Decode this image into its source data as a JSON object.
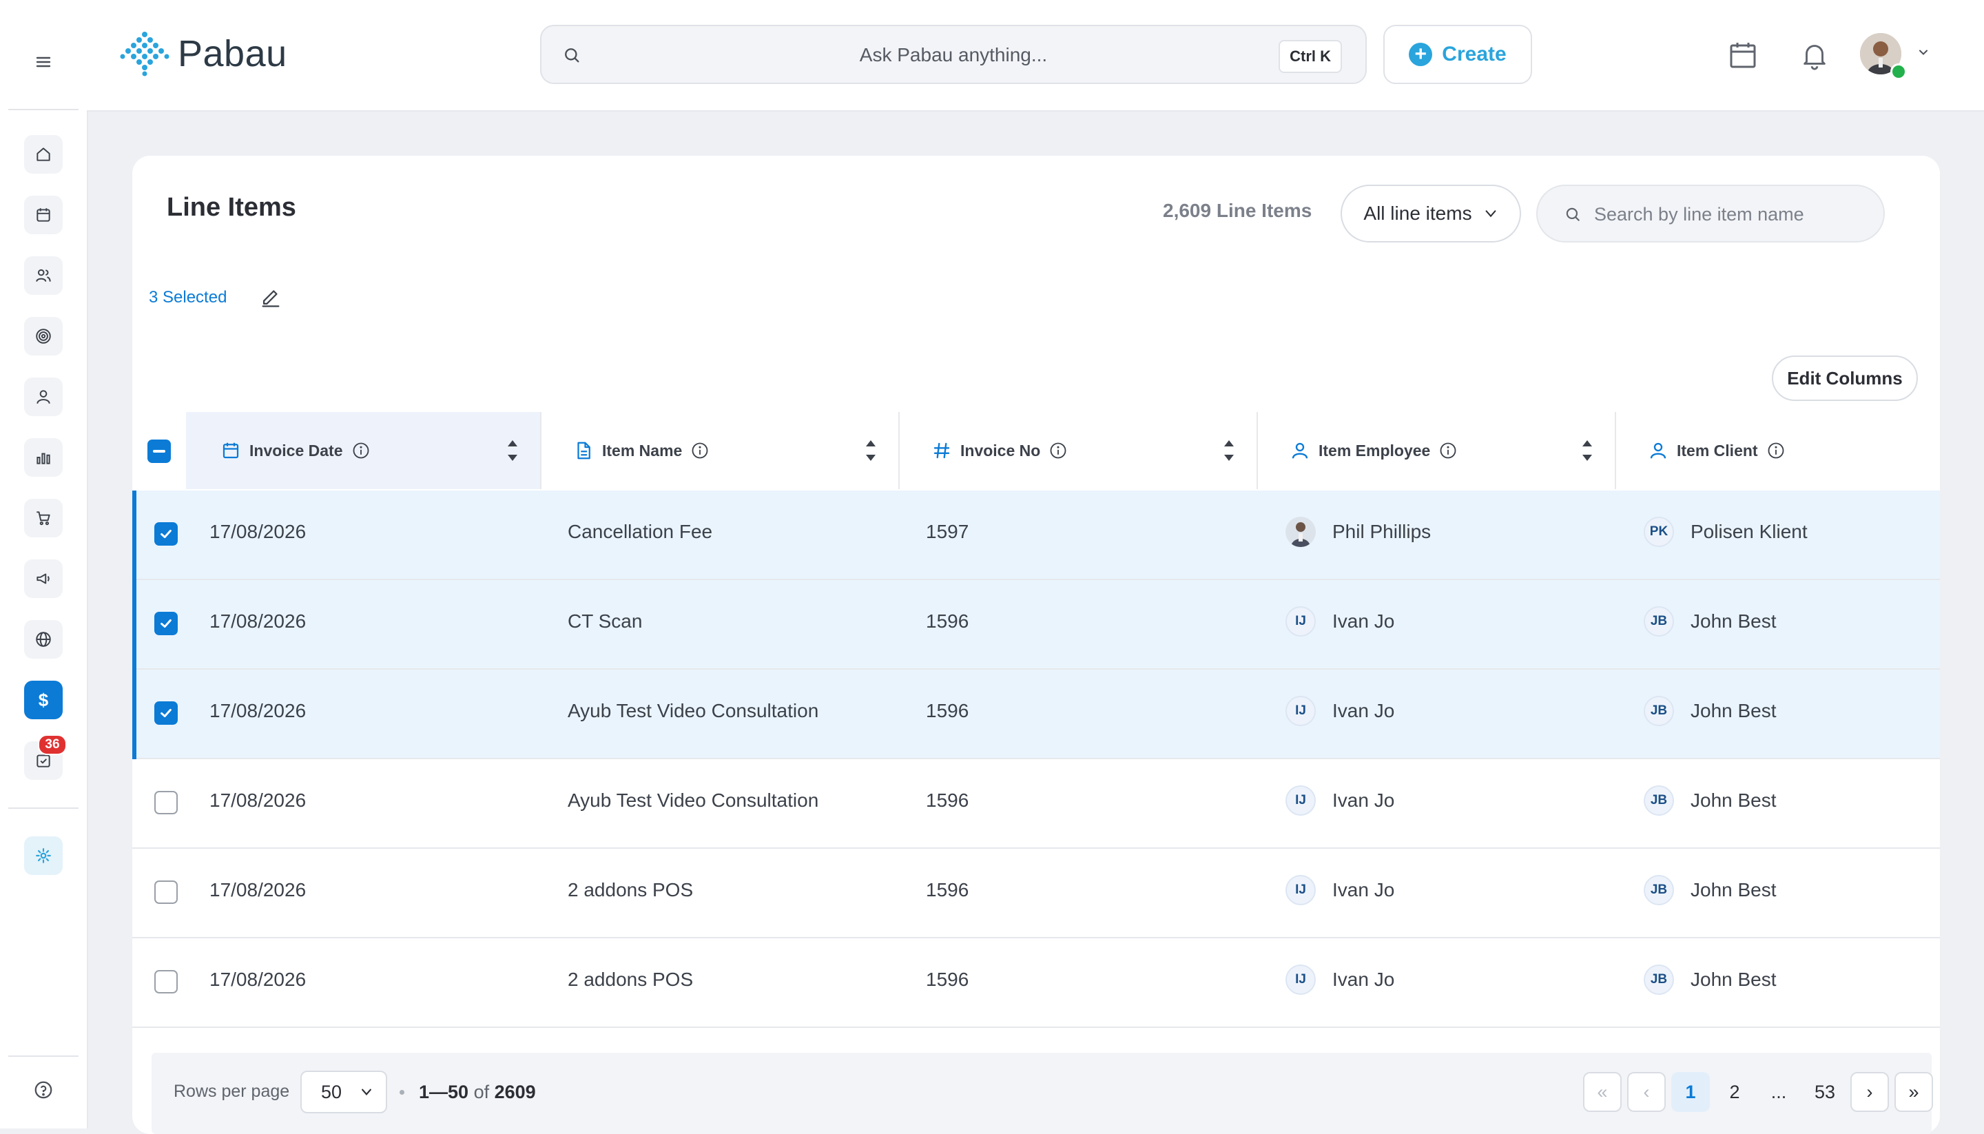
{
  "app": {
    "name": "Pabau"
  },
  "topbar": {
    "ai_search_placeholder": "Ask Pabau anything...",
    "shortcut": "Ctrl K",
    "create_label": "Create"
  },
  "sidebar": {
    "tasks_badge": "36"
  },
  "page": {
    "title": "Line Items",
    "count_label": "2,609 Line Items",
    "filter_label": "All line items",
    "search_placeholder": "Search by line item name",
    "selected_label": "3 Selected",
    "edit_columns_label": "Edit Columns"
  },
  "table": {
    "columns": [
      "Invoice Date",
      "Item Name",
      "Invoice No",
      "Item Employee",
      "Item Client"
    ],
    "rows": [
      {
        "date": "17/08/2026",
        "item": "Cancellation Fee",
        "invoice": "1597",
        "employee": "Phil Phillips",
        "employee_initials": "",
        "client": "Polisen Klient",
        "client_initials": "PK",
        "selected": true
      },
      {
        "date": "17/08/2026",
        "item": "CT Scan",
        "invoice": "1596",
        "employee": "Ivan Jo",
        "employee_initials": "IJ",
        "client": "John Best",
        "client_initials": "JB",
        "selected": true
      },
      {
        "date": "17/08/2026",
        "item": "Ayub Test Video Consultation",
        "invoice": "1596",
        "employee": "Ivan Jo",
        "employee_initials": "IJ",
        "client": "John Best",
        "client_initials": "JB",
        "selected": true
      },
      {
        "date": "17/08/2026",
        "item": "Ayub Test Video Consultation",
        "invoice": "1596",
        "employee": "Ivan Jo",
        "employee_initials": "IJ",
        "client": "John Best",
        "client_initials": "JB",
        "selected": false
      },
      {
        "date": "17/08/2026",
        "item": "2 addons POS",
        "invoice": "1596",
        "employee": "Ivan Jo",
        "employee_initials": "IJ",
        "client": "John Best",
        "client_initials": "JB",
        "selected": false
      },
      {
        "date": "17/08/2026",
        "item": "2 addons POS",
        "invoice": "1596",
        "employee": "Ivan Jo",
        "employee_initials": "IJ",
        "client": "John Best",
        "client_initials": "JB",
        "selected": false
      }
    ]
  },
  "pagination": {
    "rows_per_page_label": "Rows per page",
    "rows_per_page": "50",
    "range": "1—50",
    "of": "of",
    "total": "2609",
    "pages": [
      "1",
      "2",
      "...",
      "53"
    ]
  },
  "colors": {
    "accent": "#0b7bd6",
    "brand": "#2aa4dc",
    "badge": "#e03131"
  }
}
